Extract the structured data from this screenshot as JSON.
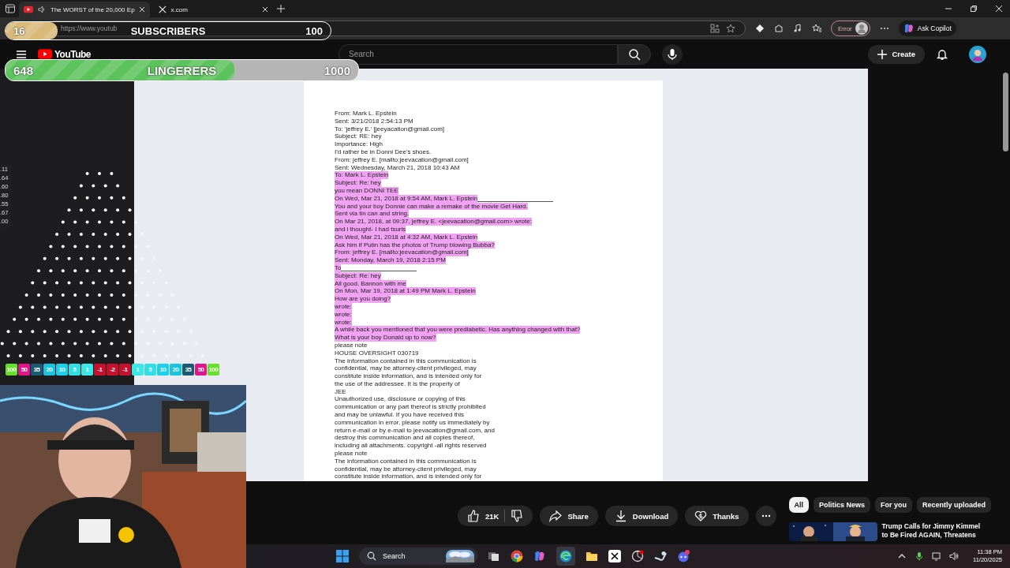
{
  "browser": {
    "tabs": [
      {
        "title": "The WORST of the 20,000 Ep",
        "selected": true,
        "kind": "youtube"
      },
      {
        "title": "x.com",
        "selected": false,
        "kind": "x"
      }
    ],
    "address": "https://www.youtub",
    "profile_status": "Error",
    "copilot": "Ask Copilot"
  },
  "youtube": {
    "logo": "YouTube",
    "search": {
      "placeholder": "Search"
    },
    "create": "Create"
  },
  "document": {
    "lines": [
      {
        "text": "From: Mark L. Epstein",
        "highlighted": false
      },
      {
        "text": "Sent: 3/21/2018 2:54:13 PM",
        "highlighted": false
      },
      {
        "text": "To: 'jeffrey E.' [jeeyacation@gmail.com]",
        "highlighted": false
      },
      {
        "text": "Subject: RE: hey",
        "highlighted": false
      },
      {
        "text": "Importance: High",
        "highlighted": false
      },
      {
        "text": "I'd rather be in Donni Dee's shoes.",
        "highlighted": false
      },
      {
        "text": "From: jeffrey E. [mailto:jeevacation@gmail.com]",
        "highlighted": false
      },
      {
        "text": "Sent: Wednesday, March 21, 2018 10:43 AM",
        "highlighted": false
      },
      {
        "text": "To: Mark L. Epstein",
        "highlighted": true
      },
      {
        "text": "Subject: Re: hey",
        "highlighted": true
      },
      {
        "text": "you mean DONNI TEE",
        "highlighted": true
      },
      {
        "text": "On Wed, Mar 21, 2018 at 9:54 AM, Mark L. Epstein",
        "highlighted": true,
        "blank_after": true
      },
      {
        "text": "You and your boy Donnie can make a remake of the movie Get Hard.",
        "highlighted": true
      },
      {
        "text": "Sent via tin can and string.",
        "highlighted": true
      },
      {
        "text": "On Mar 21, 2018, at 09:37, jeffrey E. <jeevacation@gmail.com> wrote:",
        "highlighted": true
      },
      {
        "text": "and i thought- I had tsuris",
        "highlighted": true
      },
      {
        "text": "On Wed, Mar 21, 2018 at 4:32 AM, Mark L. Epstein",
        "highlighted": true
      },
      {
        "text": "Ask him if Putin has the photos of Trump blowing Bubba?",
        "highlighted": true
      },
      {
        "text": "From: jeffrey E. [mailto:jeevacation@gmail.com]",
        "highlighted": true
      },
      {
        "text": "Sent: Monday, March 19, 2018 2:15 PM",
        "highlighted": true
      },
      {
        "text": "To",
        "highlighted": true,
        "blank_after": true
      },
      {
        "text": "Subject: Re: hey",
        "highlighted": true
      },
      {
        "text": "All good. Bannon with me",
        "highlighted": true
      },
      {
        "text": "On Mon, Mar 19, 2018 at 1:49 PM Mark L. Epstein",
        "highlighted": true
      },
      {
        "text": "How are you doing?",
        "highlighted": true
      },
      {
        "text": "wrote:",
        "highlighted": true
      },
      {
        "text": "wrote:",
        "highlighted": true
      },
      {
        "text": "wrote:",
        "highlighted": true
      },
      {
        "text": "A while back you mentioned that you were prediabetic. Has anything changed with that?",
        "highlighted": true
      },
      {
        "text": "What is your boy Donald up to now?",
        "highlighted": true
      },
      {
        "text": "please note",
        "highlighted": false
      },
      {
        "text": "HOUSE OVERSIGHT 030719",
        "highlighted": false
      },
      {
        "text": "The information contained in this communication is",
        "highlighted": false
      },
      {
        "text": "confidential, may be attorney-client privileged, may",
        "highlighted": false
      },
      {
        "text": "constitute inside information, and is intended only for",
        "highlighted": false
      },
      {
        "text": "the use of the addressee. It is the property of",
        "highlighted": false
      },
      {
        "text": "JEE",
        "highlighted": false
      },
      {
        "text": "Unauthorized use, disclosure or copying of this",
        "highlighted": false
      },
      {
        "text": "communication or any part thereof is strictly prohibited",
        "highlighted": false
      },
      {
        "text": "and may be unlawful. If you have received this",
        "highlighted": false
      },
      {
        "text": "communication in error, please notify us immediately by",
        "highlighted": false
      },
      {
        "text": "return e-mail or by e-mail to jeevacation@gmail.com, and",
        "highlighted": false
      },
      {
        "text": "destroy this communication and all copies thereof,",
        "highlighted": false
      },
      {
        "text": "including all attachments. copyright -all rights reserved",
        "highlighted": false
      },
      {
        "text": "please note",
        "highlighted": false
      },
      {
        "text": "The information contained in this communication is",
        "highlighted": false
      },
      {
        "text": "confidential, may be attorney-client privileged, may",
        "highlighted": false
      },
      {
        "text": "constitute inside information, and is intended only for",
        "highlighted": false
      }
    ]
  },
  "actions": {
    "likes": "21K",
    "buttons": [
      {
        "label": "Share",
        "kind": "share"
      },
      {
        "label": "Download",
        "kind": "download"
      },
      {
        "label": "Thanks",
        "kind": "thanks"
      }
    ]
  },
  "chips": [
    {
      "label": "All",
      "selected": true
    },
    {
      "label": "Politics News",
      "selected": false
    },
    {
      "label": "For you",
      "selected": false
    },
    {
      "label": "Recently uploaded",
      "selected": false
    }
  ],
  "recommendation": {
    "title_lines": [
      "Trump Calls for Jimmy Kimmel",
      "to Be Fired AGAIN, Threatens"
    ]
  },
  "goals": [
    {
      "count": "16",
      "label": "SUBSCRIBERS",
      "target": "100",
      "level": 0.16,
      "color": "#d9b97a"
    },
    {
      "count": "648",
      "label": "LINGERERS",
      "target": "1000",
      "level": 0.648,
      "color": "#5cc25c"
    }
  ],
  "plinko": {
    "side_numbers": [
      ".11",
      ".64",
      ".60",
      ".80",
      ".55",
      ".67",
      ".00"
    ],
    "slots": [
      {
        "label": "100",
        "color": "#66e02a"
      },
      {
        "label": "50",
        "color": "#e0168a"
      },
      {
        "label": "35",
        "color": "#1a5a72"
      },
      {
        "label": "20",
        "color": "#19c4e0"
      },
      {
        "label": "10",
        "color": "#1ad0ea"
      },
      {
        "label": "5",
        "color": "#2ee0e6"
      },
      {
        "label": "1",
        "color": "#3ae8e8"
      },
      {
        "label": "-1",
        "color": "#c8102e"
      },
      {
        "label": "-2",
        "color": "#c8102e"
      },
      {
        "label": "-1",
        "color": "#c8102e"
      },
      {
        "label": "1",
        "color": "#3ae8e8"
      },
      {
        "label": "5",
        "color": "#2ee0e6"
      },
      {
        "label": "10",
        "color": "#1ad0ea"
      },
      {
        "label": "20",
        "color": "#19c4e0"
      },
      {
        "label": "35",
        "color": "#1a5a72"
      },
      {
        "label": "50",
        "color": "#e0168a"
      },
      {
        "label": "100",
        "color": "#66e02a"
      }
    ]
  },
  "taskbar": {
    "search": "Search",
    "time": "11:38 PM",
    "date": "11/20/2025"
  }
}
